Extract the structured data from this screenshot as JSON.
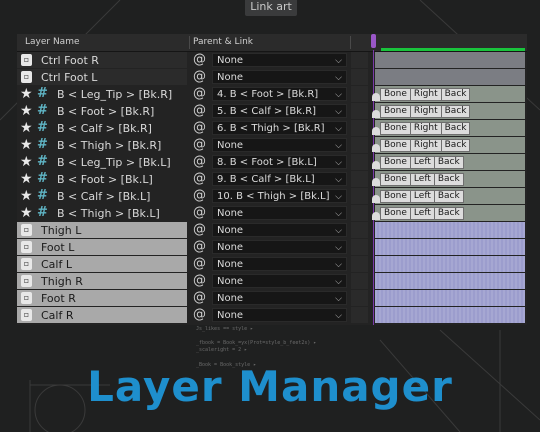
{
  "top_tab": "Link art",
  "header": {
    "layer_name": "Layer Name",
    "parent_link": "Parent & Link"
  },
  "tag_labels": {
    "bone": "Bone",
    "right": "Right",
    "left": "Left",
    "back": "Back"
  },
  "icons": {
    "pickwhip": "@",
    "star": "★",
    "hash": "#",
    "chevron": "⌵"
  },
  "title": "Layer Manager",
  "colors": {
    "title": "#1e8fcd",
    "cti": "#9a57c8",
    "work_area": "#19c43c"
  },
  "layers": [
    {
      "type": "ctrl",
      "name": "Ctrl Foot R",
      "parent": "None"
    },
    {
      "type": "ctrl",
      "name": "Ctrl Foot L",
      "parent": "None"
    },
    {
      "type": "null",
      "name": "B < Leg_Tip > [Bk.R]",
      "parent": "4. B < Foot > [Bk.R]",
      "side": "right"
    },
    {
      "type": "null",
      "name": "B < Foot > [Bk.R]",
      "parent": "5. B < Calf > [Bk.R]",
      "side": "right"
    },
    {
      "type": "null",
      "name": "B < Calf > [Bk.R]",
      "parent": "6. B < Thigh > [Bk.R]",
      "side": "right"
    },
    {
      "type": "null",
      "name": "B < Thigh > [Bk.R]",
      "parent": "None",
      "side": "right"
    },
    {
      "type": "null",
      "name": "B < Leg_Tip > [Bk.L]",
      "parent": "8. B < Foot > [Bk.L]",
      "side": "left"
    },
    {
      "type": "null",
      "name": "B < Foot > [Bk.L]",
      "parent": "9. B < Calf > [Bk.L]",
      "side": "left"
    },
    {
      "type": "null",
      "name": "B < Calf > [Bk.L]",
      "parent": "10. B < Thigh > [Bk.L]",
      "side": "left"
    },
    {
      "type": "null",
      "name": "B < Thigh > [Bk.L]",
      "parent": "None",
      "side": "left"
    },
    {
      "type": "shape",
      "name": "Thigh L",
      "parent": "None"
    },
    {
      "type": "shape",
      "name": "Foot L",
      "parent": "None"
    },
    {
      "type": "shape",
      "name": "Calf L",
      "parent": "None"
    },
    {
      "type": "shape",
      "name": "Thigh R",
      "parent": "None"
    },
    {
      "type": "shape",
      "name": "Foot R",
      "parent": "None"
    },
    {
      "type": "shape",
      "name": "Calf R",
      "parent": "None"
    }
  ]
}
